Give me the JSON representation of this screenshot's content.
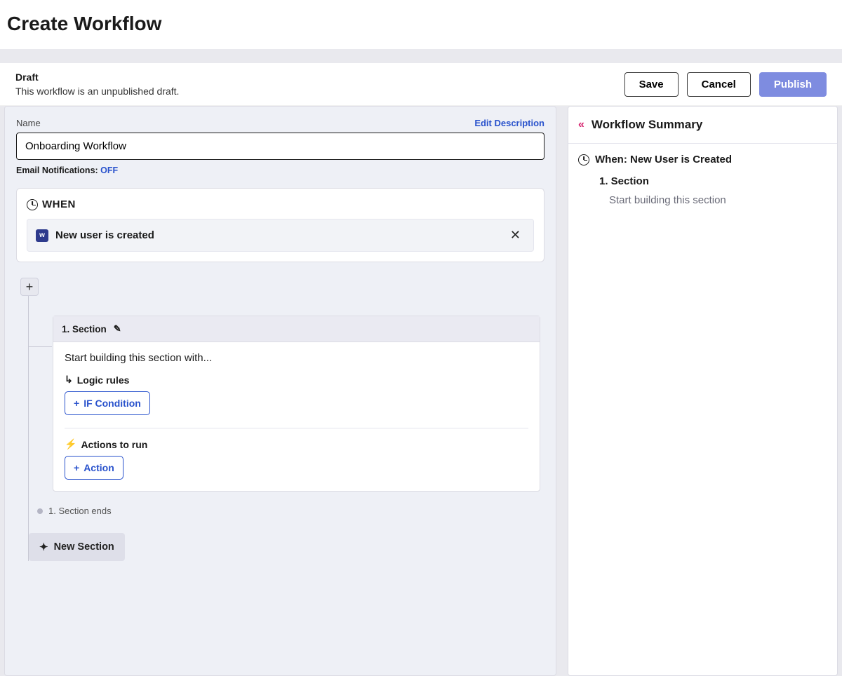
{
  "page": {
    "title": "Create Workflow"
  },
  "status": {
    "title": "Draft",
    "description": "This workflow is an unpublished draft.",
    "save_label": "Save",
    "cancel_label": "Cancel",
    "publish_label": "Publish"
  },
  "form": {
    "name_label": "Name",
    "edit_description_label": "Edit Description",
    "name_value": "Onboarding Workflow",
    "email_label": "Email Notifications:",
    "email_state": "OFF"
  },
  "when": {
    "heading": "WHEN",
    "trigger_badge": "w",
    "trigger_text": "New user is created"
  },
  "flow": {
    "add_label": "+",
    "section_head": "1.  Section",
    "section_prompt": "Start building this section with...",
    "logic_label": "Logic rules",
    "if_condition_label": "IF Condition",
    "actions_label": "Actions to run",
    "action_label": "Action",
    "section_end_label": "1. Section ends",
    "new_section_label": "New Section"
  },
  "summary": {
    "title": "Workflow Summary",
    "when_line": "When: New User is Created",
    "section_line": "1. Section",
    "section_detail": "Start building this section"
  }
}
